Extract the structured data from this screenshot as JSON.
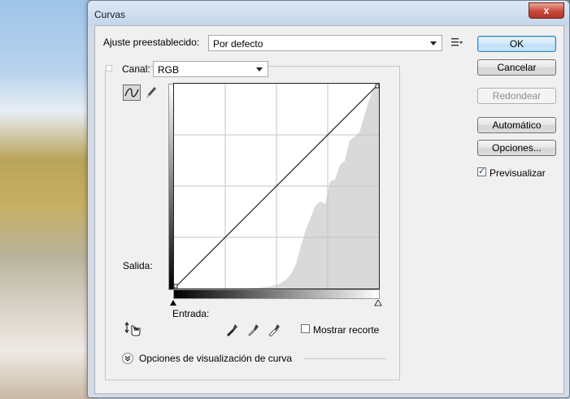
{
  "window": {
    "title": "Curvas",
    "close_glyph": "x"
  },
  "preset": {
    "label": "Ajuste preestablecido:",
    "value": "Por defecto"
  },
  "channel": {
    "label": "Canal:",
    "value": "RGB"
  },
  "buttons": {
    "ok": "OK",
    "cancel": "Cancelar",
    "smooth": "Redondear",
    "auto": "Automático",
    "options": "Opciones..."
  },
  "preview": {
    "label": "Previsualizar",
    "checked": true
  },
  "graph": {
    "output_label": "Salida:",
    "input_label": "Entrada:"
  },
  "clipping": {
    "label": "Mostrar recorte",
    "checked": false
  },
  "curve_display": {
    "label": "Opciones de visualización de curva"
  },
  "icons": [
    "preset-menu-icon",
    "curve-tool-icon",
    "pencil-tool-icon",
    "targeted-adjust-icon",
    "black-eyedropper-icon",
    "gray-eyedropper-icon",
    "white-eyedropper-icon",
    "expand-chevron-icon"
  ]
}
